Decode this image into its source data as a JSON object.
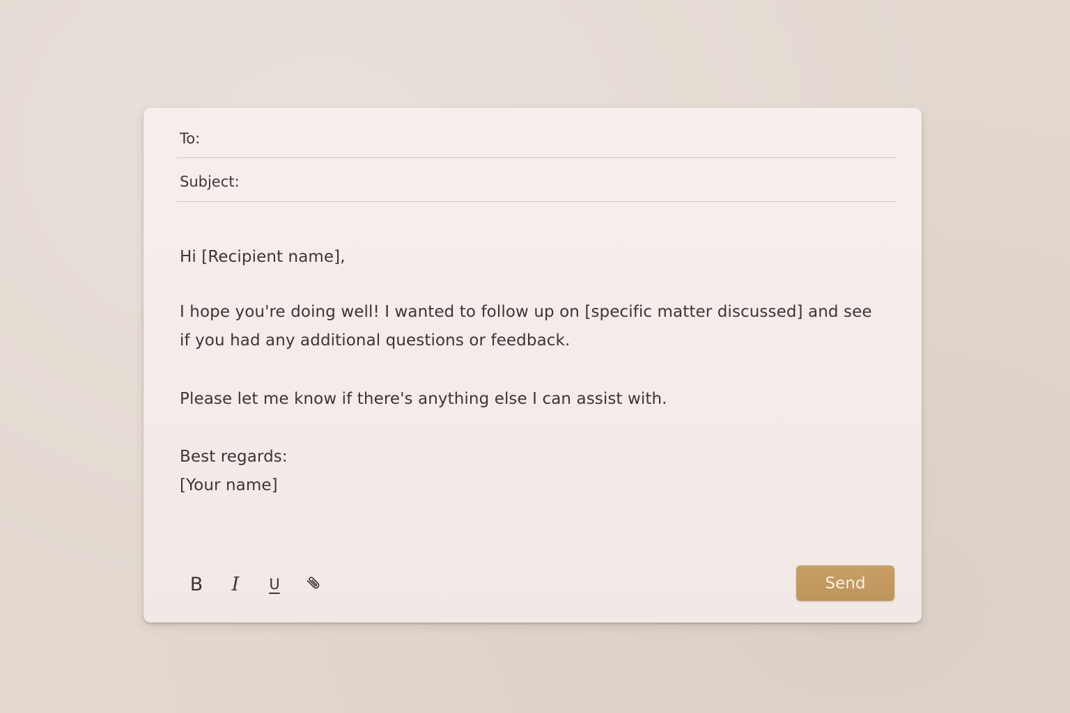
{
  "compose": {
    "to_label": "To:",
    "to_value": "",
    "subject_label": "Subject:",
    "subject_value": "",
    "body": {
      "greeting": "Hi [Recipient name],",
      "paragraph1": "I hope you're doing well! I wanted to follow up on [specific matter discussed] and see if you had any additional questions or feedback.",
      "paragraph2": "Please let me know if there's anything else I can assist with.",
      "signoff": "Best regards:",
      "signature": "[Your name]"
    }
  },
  "toolbar": {
    "bold_label": "B",
    "italic_label": "I",
    "underline_label": "U",
    "attach_icon": "paperclip-icon"
  },
  "actions": {
    "send_label": "Send"
  },
  "colors": {
    "accent": "#c39a62",
    "card": "#f3ebe8",
    "background": "#e3d9d1",
    "text": "#3b3633"
  }
}
